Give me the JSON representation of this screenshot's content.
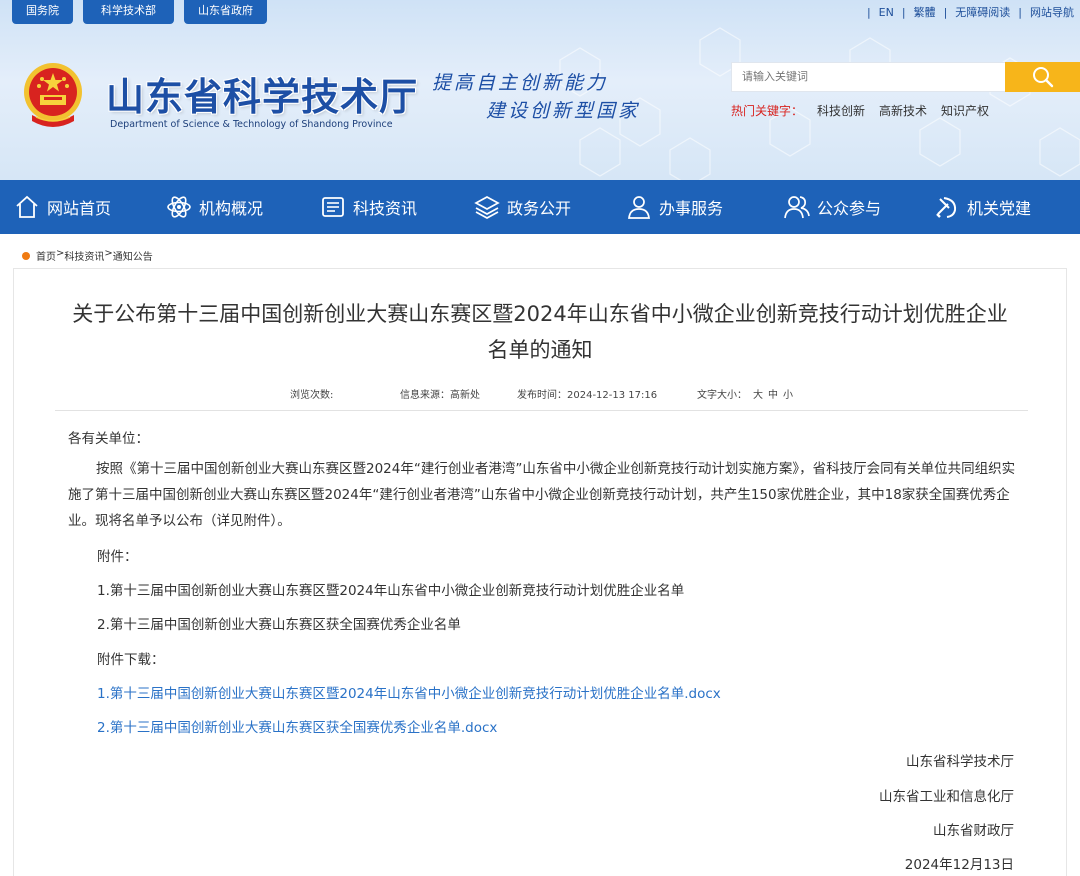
{
  "top_links": [
    "国务院",
    "科学技术部",
    "山东省政府"
  ],
  "util": {
    "en": "EN",
    "trad": "繁體",
    "access": "无障碍阅读",
    "sitemap": "网站导航"
  },
  "site": {
    "title": "山东省科学技术厅",
    "subtitle": "Department of Science & Technology of Shandong Province",
    "slogan_line1": "提高自主创新能力",
    "slogan_line2": "建设创新型国家"
  },
  "search": {
    "placeholder": "请输入关键词"
  },
  "hot": {
    "label": "热门关键字：",
    "items": [
      "科技创新",
      "高新技术",
      "知识产权"
    ]
  },
  "nav": [
    "网站首页",
    "机构概况",
    "科技资讯",
    "政务公开",
    "办事服务",
    "公众参与",
    "机关党建"
  ],
  "breadcrumb": {
    "home": "首页",
    "sep1": ">",
    "section": "科技资讯",
    "sep2": ">",
    "current": "通知公告"
  },
  "article": {
    "title_line1": "关于公布第十三届中国创新创业大赛山东赛区暨2024年山东省中小微企业创新竞技行动计划优胜企业",
    "title_line2": "名单的通知",
    "meta": {
      "views_label": "浏览次数:",
      "source": "信息来源：高新处",
      "time": "发布时间：2024-12-13 17:16",
      "font_label": "文字大小：",
      "font_big": "大",
      "font_mid": "中",
      "font_small": "小"
    },
    "greeting": "各有关单位：",
    "body": "按照《第十三届中国创新创业大赛山东赛区暨2024年“建行创业者港湾”山东省中小微企业创新竞技行动计划实施方案》，省科技厅会同有关单位共同组织实施了第十三届中国创新创业大赛山东赛区暨2024年“建行创业者港湾”山东省中小微企业创新竞技行动计划，共产生150家优胜企业，其中18家获全国赛优秀企业。现将名单予以公布（详见附件）。",
    "attachment_label": "附件：",
    "attachments": [
      "1.第十三届中国创新创业大赛山东赛区暨2024年山东省中小微企业创新竞技行动计划优胜企业名单",
      "2.第十三届中国创新创业大赛山东赛区获全国赛优秀企业名单"
    ],
    "download_label": "附件下载：",
    "downloads": [
      "1.第十三届中国创新创业大赛山东赛区暨2024年山东省中小微企业创新竞技行动计划优胜企业名单.docx",
      "2.第十三届中国创新创业大赛山东赛区获全国赛优秀企业名单.docx"
    ],
    "signatures": [
      "山东省科学技术厅",
      "山东省工业和信息化厅",
      "山东省财政厅"
    ],
    "date": "2024年12月13日"
  },
  "colors": {
    "nav_blue": "#1e62b8",
    "accent_orange": "#f07b12",
    "search_yellow": "#f7b51a",
    "hot_red": "#d8231f",
    "link_blue": "#2a72c7"
  }
}
